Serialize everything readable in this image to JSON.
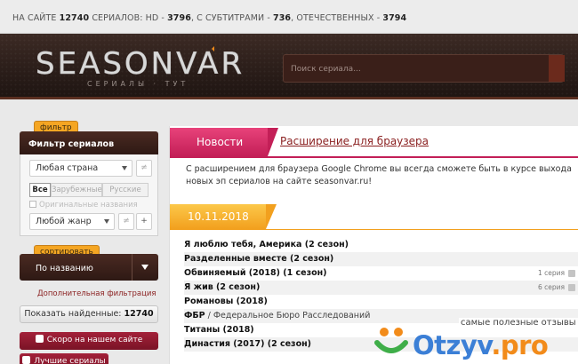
{
  "topbar": {
    "p1": "НА САЙТЕ",
    "total": "12740",
    "p2": "СЕРИАЛОВ: HD -",
    "hd": "3796",
    "p3": ", С СУБТИТРАМИ -",
    "subs": "736",
    "p4": ", ОТЕЧЕСТВЕННЫХ -",
    "domestic": "3794"
  },
  "header": {
    "logo_text": "SEASONVAR",
    "logo_sub": "СЕРИАЛЫ · ТУТ",
    "search_placeholder": "Поиск сериала..."
  },
  "sidebar": {
    "filter_tag": "фильтр",
    "filter_title": "Фильтр сериалов",
    "country": "Любая страна",
    "seg_all": "Все",
    "seg_foreign": "Зарубежные",
    "seg_russian": "Русские",
    "orig_names": "Оригинальные названия",
    "genre": "Любой жанр",
    "mini_neq": "≠",
    "mini_plus": "+",
    "sort_tag": "сортировать",
    "sort_value": "По названию",
    "more_filters": "Дополнительная фильтрация",
    "found_label": "Показать найденные:",
    "found_count": "12740",
    "soon_label": "Скоро на нашем сайте",
    "best_label": "Лучшие сериалы"
  },
  "main": {
    "news_tab": "Новости",
    "news_title": "Расширение для браузера",
    "news_text": "С расширением для браузера Google Chrome вы всегда сможете быть в курсе выхода новых эп сериалов на сайте seasonvar.ru!",
    "date": "10.11.2018",
    "rows": [
      {
        "title": "Я люблю тебя, Америка (2 сезон)",
        "rest": "",
        "ep": ""
      },
      {
        "title": "Разделенные вместе (2 сезон)",
        "rest": "",
        "ep": ""
      },
      {
        "title": "Обвиняемый (2018) (1 сезон)",
        "rest": "",
        "ep": "1 серия"
      },
      {
        "title": "Я жив (2 сезон)",
        "rest": "",
        "ep": "6 серия"
      },
      {
        "title": "Романовы (2018)",
        "rest": "",
        "ep": ""
      },
      {
        "title": "ФБР",
        "rest": " / Федеральное Бюро Расследований",
        "ep": ""
      },
      {
        "title": "Титаны (2018)",
        "rest": "",
        "ep": ""
      },
      {
        "title": "Династия (2017) (2 сезон)",
        "rest": "",
        "ep": ""
      }
    ]
  },
  "watermark": {
    "slogan": "самые полезные отзывы",
    "brand": "Otzyv",
    "tld": ".pro"
  },
  "colors": {
    "header_bg": "#2a1d19",
    "news_tab": "#c31f57",
    "date_tab": "#f2a01e",
    "accent_link": "#8a1f1f"
  }
}
